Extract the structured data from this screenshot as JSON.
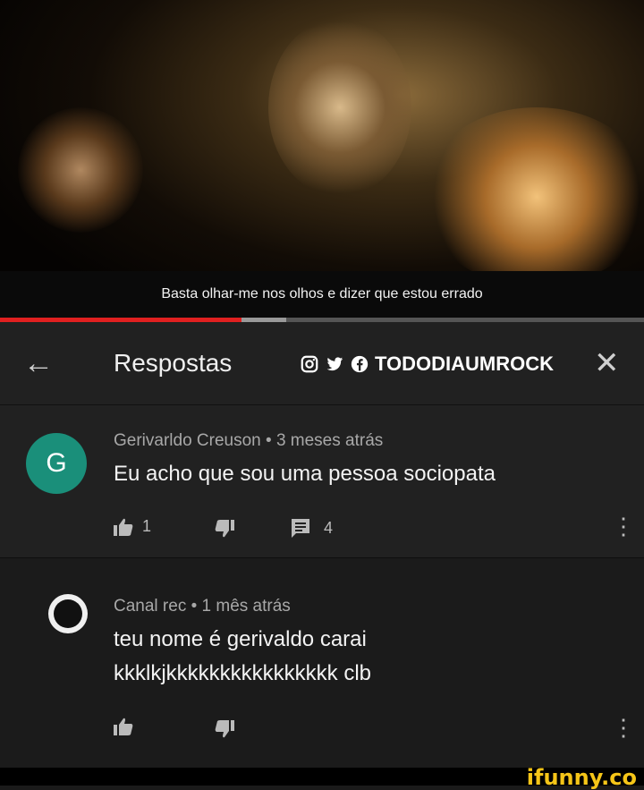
{
  "video": {
    "caption": "Basta olhar-me nos olhos e dizer que estou errado",
    "progress": 0.375
  },
  "header": {
    "title": "Respostas",
    "watermark": "TODODIAUMROCK",
    "back_icon": "arrow-left-icon",
    "close_icon": "close-icon"
  },
  "comments": [
    {
      "avatar_letter": "G",
      "avatar_color": "#1a8f7a",
      "author": "Gerivarldo Creuson",
      "time": "3 meses atrás",
      "meta": "Gerivarldo Creuson • 3 meses atrás",
      "text": "Eu acho que sou uma pessoa sociopata",
      "likes": "1",
      "replies": "4"
    },
    {
      "author": "Canal rec",
      "time": "1 mês atrás",
      "meta": "Canal rec • 1 mês atrás",
      "text_line1": "teu nome é gerivaldo carai",
      "text_line2": "kkklkjkkkkkkkkkkkkkkkk clb"
    }
  ],
  "branding": {
    "site": "ifunny.co",
    "color": "#f5c518"
  }
}
